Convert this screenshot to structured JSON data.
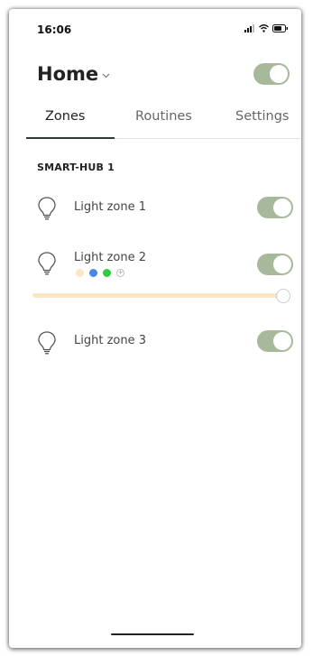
{
  "status_bar": {
    "time": "16:06"
  },
  "header": {
    "title": "Home",
    "master_toggle_on": true
  },
  "tabs": [
    {
      "label": "Zones",
      "active": true
    },
    {
      "label": "Routines",
      "active": false
    },
    {
      "label": "Settings",
      "active": false
    }
  ],
  "section": {
    "title": "SMART-HUB 1"
  },
  "zones": [
    {
      "label": "Light zone 1",
      "on": true,
      "icon": "lightbulb-icon"
    },
    {
      "label": "Light zone 2",
      "on": true,
      "icon": "lightbulb-icon"
    },
    {
      "label": "Light zone 3",
      "on": true,
      "icon": "lightbulb-icon"
    }
  ],
  "zone2_colors": [
    "#fde6c4",
    "#4a86e8",
    "#2ecc40"
  ],
  "zone2_brightness": 1.0,
  "colors": {
    "toggle_on": "#a7b89b",
    "slider": "#fde6c4",
    "tab_underline": "#2d3a3a"
  }
}
